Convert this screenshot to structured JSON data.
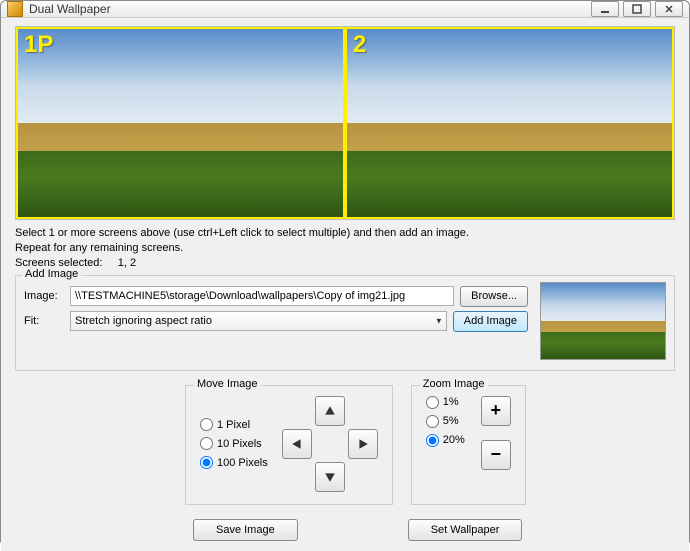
{
  "window": {
    "title": "Dual Wallpaper"
  },
  "screens": [
    {
      "label": "1P"
    },
    {
      "label": "2"
    }
  ],
  "instructions": {
    "line1": "Select 1 or more screens above (use ctrl+Left click to select multiple) and then add an image.",
    "line2": "Repeat for any remaining screens.",
    "selected_label": "Screens selected:",
    "selected_value": "1, 2"
  },
  "add_image": {
    "group_title": "Add Image",
    "image_label": "Image:",
    "image_path": "\\\\TESTMACHINE5\\storage\\Download\\wallpapers\\Copy of img21.jpg",
    "browse_label": "Browse...",
    "fit_label": "Fit:",
    "fit_value": "Stretch ignoring aspect ratio",
    "add_label": "Add Image"
  },
  "move": {
    "title": "Move Image",
    "options": [
      {
        "label": "1 Pixel",
        "checked": false
      },
      {
        "label": "10 Pixels",
        "checked": false
      },
      {
        "label": "100 Pixels",
        "checked": true
      }
    ]
  },
  "zoom": {
    "title": "Zoom Image",
    "options": [
      {
        "label": "1%",
        "checked": false
      },
      {
        "label": "5%",
        "checked": false
      },
      {
        "label": "20%",
        "checked": true
      }
    ],
    "plus": "+",
    "minus": "−"
  },
  "bottom": {
    "save_label": "Save Image",
    "set_label": "Set Wallpaper"
  }
}
